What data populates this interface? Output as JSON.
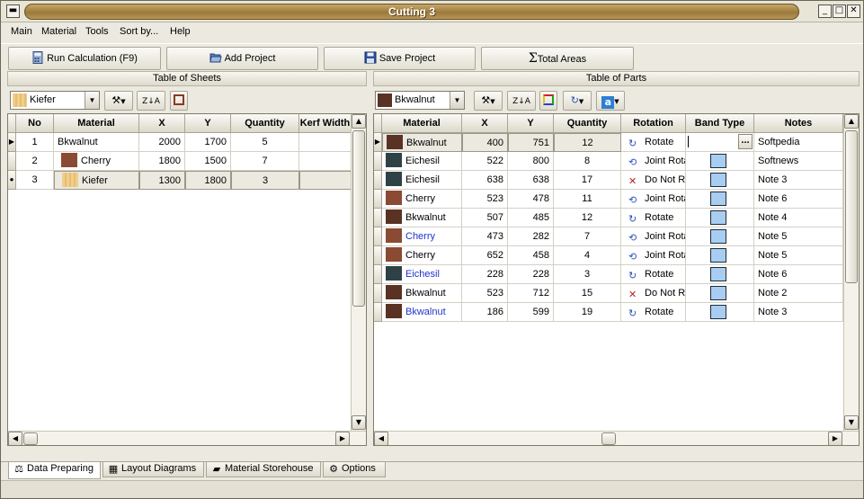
{
  "window": {
    "title": "Cutting 3",
    "controls": [
      "_",
      "□",
      "✕"
    ]
  },
  "menu": [
    "Main",
    "Material",
    "Tools",
    "Sort by...",
    "Help"
  ],
  "toolbar": {
    "run": "Run Calculation (F9)",
    "add": "Add Project",
    "save": "Save Project",
    "total": "Total Areas"
  },
  "sheets": {
    "title": "Table of Sheets",
    "material_select": "Kiefer",
    "columns": [
      "No",
      "Material",
      "X",
      "Y",
      "Quantity",
      "Kerf Width"
    ],
    "rows": [
      {
        "no": "1",
        "material": "Bkwalnut",
        "x": "2000",
        "y": "1700",
        "qty": "5",
        "kerf": "",
        "swatch": ""
      },
      {
        "no": "2",
        "material": "Cherry",
        "x": "1800",
        "y": "1500",
        "qty": "7",
        "kerf": "",
        "swatch": "#8a4a34"
      },
      {
        "no": "3",
        "material": "Kiefer",
        "x": "1300",
        "y": "1800",
        "qty": "3",
        "kerf": "",
        "swatch": "#f0cf8c"
      }
    ]
  },
  "parts": {
    "title": "Table of Parts",
    "material_select": "Bkwalnut",
    "columns": [
      "Material",
      "X",
      "Y",
      "Quantity",
      "Rotation",
      "Band Type",
      "Notes"
    ],
    "rows": [
      {
        "material": "Bkwalnut",
        "x": "400",
        "y": "751",
        "qty": "12",
        "rotation": "Rotate",
        "notes": "Softpedia",
        "swatch": "#5a3224",
        "blue": false,
        "band": false
      },
      {
        "material": "Eichesil",
        "x": "522",
        "y": "800",
        "qty": "8",
        "rotation": "Joint Rota",
        "notes": "Softnews",
        "swatch": "#2e4246",
        "blue": false,
        "band": true
      },
      {
        "material": "Eichesil",
        "x": "638",
        "y": "638",
        "qty": "17",
        "rotation": "Do Not Ro",
        "notes": "Note 3",
        "swatch": "#2e4246",
        "blue": false,
        "band": true
      },
      {
        "material": "Cherry",
        "x": "523",
        "y": "478",
        "qty": "11",
        "rotation": "Joint Rota",
        "notes": "Note 6",
        "swatch": "#8a4a34",
        "blue": false,
        "band": true
      },
      {
        "material": "Bkwalnut",
        "x": "507",
        "y": "485",
        "qty": "12",
        "rotation": "Rotate",
        "notes": "Note 4",
        "swatch": "#5a3224",
        "blue": false,
        "band": true
      },
      {
        "material": "Cherry",
        "x": "473",
        "y": "282",
        "qty": "7",
        "rotation": "Joint Rota",
        "notes": "Note 5",
        "swatch": "#8a4a34",
        "blue": true,
        "band": true
      },
      {
        "material": "Cherry",
        "x": "652",
        "y": "458",
        "qty": "4",
        "rotation": "Joint Rota",
        "notes": "Note 5",
        "swatch": "#8a4a34",
        "blue": false,
        "band": true
      },
      {
        "material": "Eichesil",
        "x": "228",
        "y": "228",
        "qty": "3",
        "rotation": "Rotate",
        "notes": "Note 6",
        "swatch": "#2e4246",
        "blue": true,
        "band": true
      },
      {
        "material": "Bkwalnut",
        "x": "523",
        "y": "712",
        "qty": "15",
        "rotation": "Do Not Ro",
        "notes": "Note 2",
        "swatch": "#5a3224",
        "blue": false,
        "band": true
      },
      {
        "material": "Bkwalnut",
        "x": "186",
        "y": "599",
        "qty": "19",
        "rotation": "Rotate",
        "notes": "Note 3",
        "swatch": "#5a3224",
        "blue": true,
        "band": true
      }
    ],
    "band_edit": "...",
    "rotation_icons": {
      "Rotate": "rotate-icon",
      "Joint Rota": "joint-rotate-icon",
      "Do Not Ro": "no-rotate-icon"
    }
  },
  "tabs": [
    "Data Preparing",
    "Layout Diagrams",
    "Material Storehouse",
    "Options"
  ],
  "colors": {
    "accent": "#b69558",
    "band": "#a9cdf0",
    "link_blue": "#1f33c9"
  }
}
